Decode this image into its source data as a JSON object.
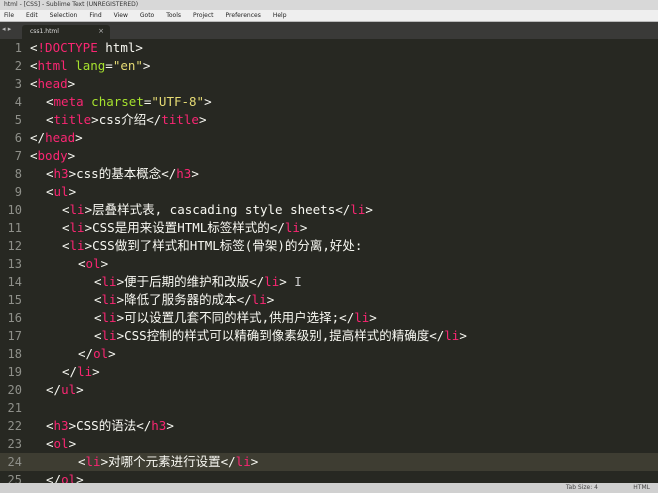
{
  "window": {
    "title": "html - [CSS] - Sublime Text (UNREGISTERED)"
  },
  "menu": [
    "File",
    "Edit",
    "Selection",
    "Find",
    "View",
    "Goto",
    "Tools",
    "Project",
    "Preferences",
    "Help"
  ],
  "tab": {
    "label": "css1.html",
    "close": "×",
    "nav": "◂ ▸"
  },
  "lines": [
    {
      "n": "1",
      "indent": 0,
      "tokens": [
        [
          "p",
          "<"
        ],
        [
          "bang",
          "!DOCTYPE"
        ],
        [
          "p",
          " html>"
        ]
      ]
    },
    {
      "n": "2",
      "indent": 0,
      "tokens": [
        [
          "p",
          "<"
        ],
        [
          "tag",
          "html"
        ],
        [
          "p",
          " "
        ],
        [
          "attr",
          "lang"
        ],
        [
          "p",
          "="
        ],
        [
          "str",
          "\"en\""
        ],
        [
          "p",
          ">"
        ]
      ]
    },
    {
      "n": "3",
      "indent": 0,
      "tokens": [
        [
          "p",
          "<"
        ],
        [
          "tag",
          "head"
        ],
        [
          "p",
          ">"
        ]
      ]
    },
    {
      "n": "4",
      "indent": 1,
      "tokens": [
        [
          "p",
          "<"
        ],
        [
          "tag",
          "meta"
        ],
        [
          "p",
          " "
        ],
        [
          "attr",
          "charset"
        ],
        [
          "p",
          "="
        ],
        [
          "str",
          "\"UTF-8\""
        ],
        [
          "p",
          ">"
        ]
      ]
    },
    {
      "n": "5",
      "indent": 1,
      "tokens": [
        [
          "p",
          "<"
        ],
        [
          "tag",
          "title"
        ],
        [
          "p",
          ">css介绍</"
        ],
        [
          "tag",
          "title"
        ],
        [
          "p",
          ">"
        ]
      ]
    },
    {
      "n": "6",
      "indent": 0,
      "tokens": [
        [
          "p",
          "</"
        ],
        [
          "tag",
          "head"
        ],
        [
          "p",
          ">"
        ]
      ]
    },
    {
      "n": "7",
      "indent": 0,
      "tokens": [
        [
          "p",
          "<"
        ],
        [
          "tag",
          "body"
        ],
        [
          "p",
          ">"
        ]
      ]
    },
    {
      "n": "8",
      "indent": 1,
      "tokens": [
        [
          "p",
          "<"
        ],
        [
          "tag",
          "h3"
        ],
        [
          "p",
          ">css的基本概念</"
        ],
        [
          "tag",
          "h3"
        ],
        [
          "p",
          ">"
        ]
      ]
    },
    {
      "n": "9",
      "indent": 1,
      "tokens": [
        [
          "p",
          "<"
        ],
        [
          "tag",
          "ul"
        ],
        [
          "p",
          ">"
        ]
      ]
    },
    {
      "n": "10",
      "indent": 2,
      "tokens": [
        [
          "p",
          "<"
        ],
        [
          "tag",
          "li"
        ],
        [
          "p",
          ">层叠样式表, cascading style sheets</"
        ],
        [
          "tag",
          "li"
        ],
        [
          "p",
          ">"
        ]
      ]
    },
    {
      "n": "11",
      "indent": 2,
      "tokens": [
        [
          "p",
          "<"
        ],
        [
          "tag",
          "li"
        ],
        [
          "p",
          ">CSS是用来设置HTML标签样式的</"
        ],
        [
          "tag",
          "li"
        ],
        [
          "p",
          ">"
        ]
      ]
    },
    {
      "n": "12",
      "indent": 2,
      "tokens": [
        [
          "p",
          "<"
        ],
        [
          "tag",
          "li"
        ],
        [
          "p",
          ">CSS做到了样式和HTML标签(骨架)的分离,好处:"
        ]
      ]
    },
    {
      "n": "13",
      "indent": 3,
      "tokens": [
        [
          "p",
          "<"
        ],
        [
          "tag",
          "ol"
        ],
        [
          "p",
          ">"
        ]
      ]
    },
    {
      "n": "14",
      "indent": 4,
      "tokens": [
        [
          "p",
          "<"
        ],
        [
          "tag",
          "li"
        ],
        [
          "p",
          ">便于后期的维护和改版</"
        ],
        [
          "tag",
          "li"
        ],
        [
          "p",
          ">"
        ],
        [
          "cur",
          " I"
        ]
      ]
    },
    {
      "n": "15",
      "indent": 4,
      "tokens": [
        [
          "p",
          "<"
        ],
        [
          "tag",
          "li"
        ],
        [
          "p",
          ">降低了服务器的成本</"
        ],
        [
          "tag",
          "li"
        ],
        [
          "p",
          ">"
        ]
      ]
    },
    {
      "n": "16",
      "indent": 4,
      "tokens": [
        [
          "p",
          "<"
        ],
        [
          "tag",
          "li"
        ],
        [
          "p",
          ">可以设置几套不同的样式,供用户选择;</"
        ],
        [
          "tag",
          "li"
        ],
        [
          "p",
          ">"
        ]
      ]
    },
    {
      "n": "17",
      "indent": 4,
      "tokens": [
        [
          "p",
          "<"
        ],
        [
          "tag",
          "li"
        ],
        [
          "p",
          ">CSS控制的样式可以精确到像素级别,提高样式的精确度</"
        ],
        [
          "tag",
          "li"
        ],
        [
          "p",
          ">"
        ]
      ]
    },
    {
      "n": "18",
      "indent": 3,
      "tokens": [
        [
          "p",
          "</"
        ],
        [
          "tag",
          "ol"
        ],
        [
          "p",
          ">"
        ]
      ]
    },
    {
      "n": "19",
      "indent": 2,
      "tokens": [
        [
          "p",
          "</"
        ],
        [
          "tag",
          "li"
        ],
        [
          "p",
          ">"
        ]
      ]
    },
    {
      "n": "20",
      "indent": 1,
      "tokens": [
        [
          "p",
          "</"
        ],
        [
          "tag",
          "ul"
        ],
        [
          "p",
          ">"
        ]
      ]
    },
    {
      "n": "21",
      "indent": 0,
      "tokens": []
    },
    {
      "n": "22",
      "indent": 1,
      "tokens": [
        [
          "p",
          "<"
        ],
        [
          "tag",
          "h3"
        ],
        [
          "p",
          ">CSS的语法</"
        ],
        [
          "tag",
          "h3"
        ],
        [
          "p",
          ">"
        ]
      ]
    },
    {
      "n": "23",
      "indent": 1,
      "tokens": [
        [
          "p",
          "<"
        ],
        [
          "tag",
          "ol"
        ],
        [
          "p",
          ">"
        ]
      ]
    },
    {
      "n": "24",
      "indent": 3,
      "current": true,
      "tokens": [
        [
          "p",
          "<"
        ],
        [
          "tag",
          "li"
        ],
        [
          "p",
          ">对哪个元素进行设置</"
        ],
        [
          "tag",
          "li"
        ],
        [
          "p",
          ">"
        ]
      ]
    },
    {
      "n": "25",
      "indent": 1,
      "tokens": [
        [
          "p",
          "</"
        ],
        [
          "tag",
          "ol"
        ],
        [
          "p",
          ">"
        ]
      ]
    }
  ],
  "status": {
    "tab_size": "Tab Size: 4",
    "syntax": "HTML"
  },
  "colors": {
    "background": "#272822",
    "tag": "#f92672",
    "attr": "#a6e22e",
    "string": "#e6db74",
    "text": "#f8f8f2"
  }
}
